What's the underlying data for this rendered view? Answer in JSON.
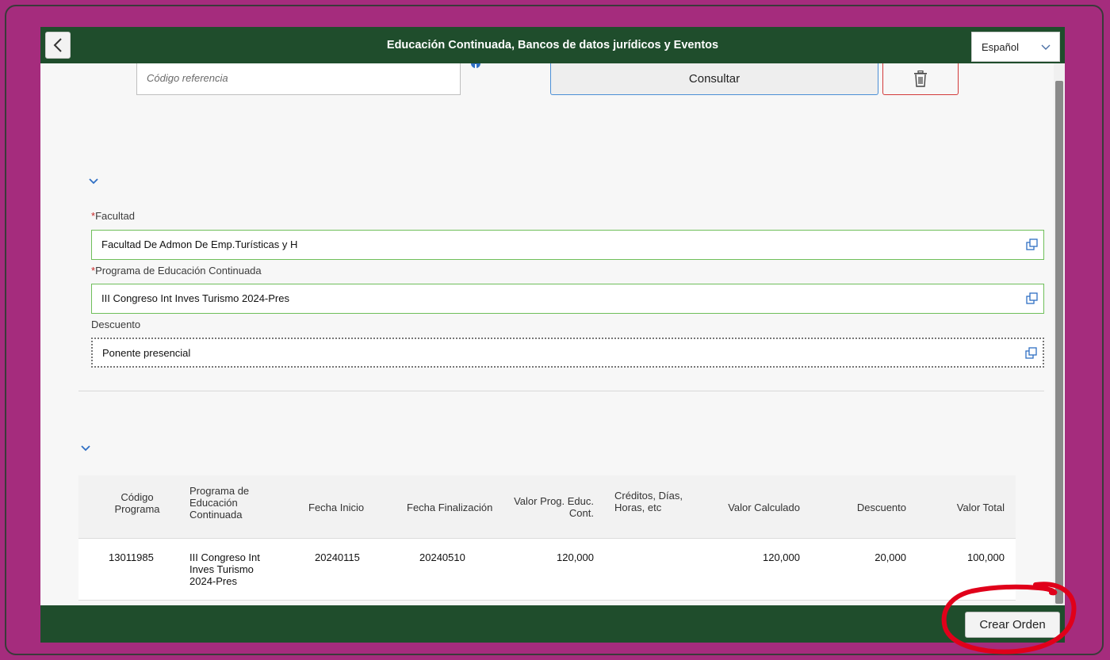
{
  "header": {
    "title": "Educación Continuada, Bancos de datos jurídicos y Eventos",
    "language": "Español"
  },
  "search": {
    "reference_placeholder": "Código referencia",
    "consultar_label": "Consultar"
  },
  "form": {
    "facultad": {
      "label": "Facultad",
      "value": "Facultad De Admon De Emp.Turísticas  y H",
      "required": true
    },
    "programa": {
      "label": "Programa de Educación Continuada",
      "value": "III Congreso Int Inves Turismo 2024-Pres",
      "required": true
    },
    "descuento": {
      "label": "Descuento",
      "value": "Ponente presencial",
      "required": false
    }
  },
  "table": {
    "columns": [
      {
        "key": "codigo",
        "label": "Código\nPrograma"
      },
      {
        "key": "programa",
        "label": "Programa de\nEducación\nContinuada"
      },
      {
        "key": "fecha_inicio",
        "label": "Fecha Inicio"
      },
      {
        "key": "fecha_fin",
        "label": "Fecha Finalización"
      },
      {
        "key": "valor_prog",
        "label": "Valor Prog. Educ.\nCont."
      },
      {
        "key": "creditos",
        "label": "Créditos, Días,\nHoras, etc"
      },
      {
        "key": "valor_calc",
        "label": "Valor Calculado"
      },
      {
        "key": "descuento",
        "label": "Descuento"
      },
      {
        "key": "valor_total",
        "label": "Valor Total"
      }
    ],
    "rows": [
      {
        "codigo": "13011985",
        "programa": "III Congreso Int\nInves Turismo\n2024-Pres",
        "fecha_inicio": "20240115",
        "fecha_fin": "20240510",
        "valor_prog": "120,000",
        "creditos": "",
        "valor_calc": "120,000",
        "descuento": "20,000",
        "valor_total": "100,000"
      }
    ]
  },
  "footer": {
    "crear_label": "Crear Orden"
  },
  "colors": {
    "page_bg": "#a52c7d",
    "header_bg": "#1f4d2c",
    "field_border": "#6fbf5a",
    "consultar_border": "#4b8fd6",
    "delete_border": "#d33a3a",
    "annotation": "#e0001a"
  }
}
